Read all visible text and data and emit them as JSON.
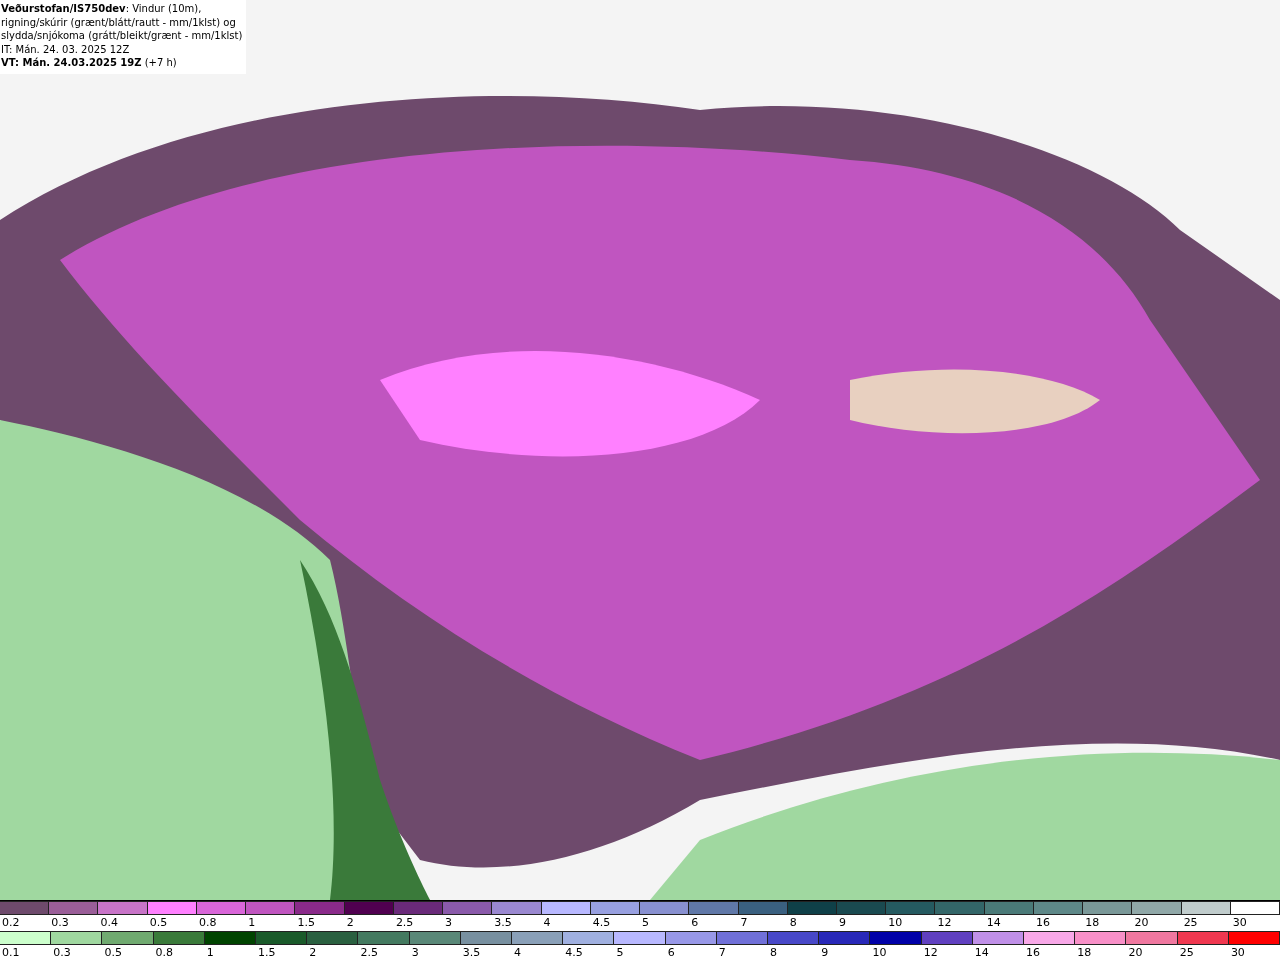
{
  "title_box": {
    "lines": [
      "**Veðurstofan/IS750dev**: Vindur (10m),",
      "rigning/skúrir (grænt/blátt/rautt - mm/1klst) og",
      "slydda/snjókoma (grátt/bleikt/grænt - mm/1klst)",
      "IT: Mán. 24. 03. 2025 12Z",
      "**VT: Mán. 24.03.2025 19Z** (+7 h)"
    ]
  },
  "legend_snow": [
    {
      "label": "0.2",
      "color": "#6e4a6c"
    },
    {
      "label": "0.3",
      "color": "#9a5e98"
    },
    {
      "label": "0.4",
      "color": "#c874c8"
    },
    {
      "label": "0.5",
      "color": "#ff80ff"
    },
    {
      "label": "0.8",
      "color": "#d966d9"
    },
    {
      "label": "1",
      "color": "#c055c0"
    },
    {
      "label": "1.5",
      "color": "#8a2a8a"
    },
    {
      "label": "2",
      "color": "#500050"
    },
    {
      "label": "2.5",
      "color": "#6a2a7a"
    },
    {
      "label": "3",
      "color": "#8a5aaa"
    },
    {
      "label": "3.5",
      "color": "#9a88d0"
    },
    {
      "label": "4",
      "color": "#b8b8ff"
    },
    {
      "label": "4.5",
      "color": "#98a0e0"
    },
    {
      "label": "5",
      "color": "#8890d0"
    },
    {
      "label": "6",
      "color": "#6078a8"
    },
    {
      "label": "7",
      "color": "#3a6080"
    },
    {
      "label": "8",
      "color": "#0f4048"
    },
    {
      "label": "9",
      "color": "#1a4a50"
    },
    {
      "label": "10",
      "color": "#255a60"
    },
    {
      "label": "12",
      "color": "#336668"
    },
    {
      "label": "14",
      "color": "#4a7a78"
    },
    {
      "label": "16",
      "color": "#5e8888"
    },
    {
      "label": "18",
      "color": "#7a9898"
    },
    {
      "label": "20",
      "color": "#90a8a8"
    },
    {
      "label": "25",
      "color": "#c0cccc"
    },
    {
      "label": "30",
      "color": "#ffffff"
    }
  ],
  "legend_rain": [
    {
      "label": "0.1",
      "color": "#ccffcc"
    },
    {
      "label": "0.3",
      "color": "#a0d8a0"
    },
    {
      "label": "0.5",
      "color": "#70aa70"
    },
    {
      "label": "0.8",
      "color": "#3a7a3a"
    },
    {
      "label": "1",
      "color": "#004400"
    },
    {
      "label": "1.5",
      "color": "#1a5a2a"
    },
    {
      "label": "2",
      "color": "#2a6040"
    },
    {
      "label": "2.5",
      "color": "#447a60"
    },
    {
      "label": "3",
      "color": "#5a8878"
    },
    {
      "label": "3.5",
      "color": "#7890a0"
    },
    {
      "label": "4",
      "color": "#8aa0b8"
    },
    {
      "label": "4.5",
      "color": "#a0b0e0"
    },
    {
      "label": "5",
      "color": "#b8b8ff"
    },
    {
      "label": "6",
      "color": "#9898e8"
    },
    {
      "label": "7",
      "color": "#7070d8"
    },
    {
      "label": "8",
      "color": "#4848c8"
    },
    {
      "label": "9",
      "color": "#2828b8"
    },
    {
      "label": "10",
      "color": "#0000a8"
    },
    {
      "label": "12",
      "color": "#6040c0"
    },
    {
      "label": "14",
      "color": "#c090e8"
    },
    {
      "label": "16",
      "color": "#f8a8e8"
    },
    {
      "label": "18",
      "color": "#f890c8"
    },
    {
      "label": "20",
      "color": "#f078a0"
    },
    {
      "label": "25",
      "color": "#f03850"
    },
    {
      "label": "30",
      "color": "#ff0000"
    }
  ]
}
